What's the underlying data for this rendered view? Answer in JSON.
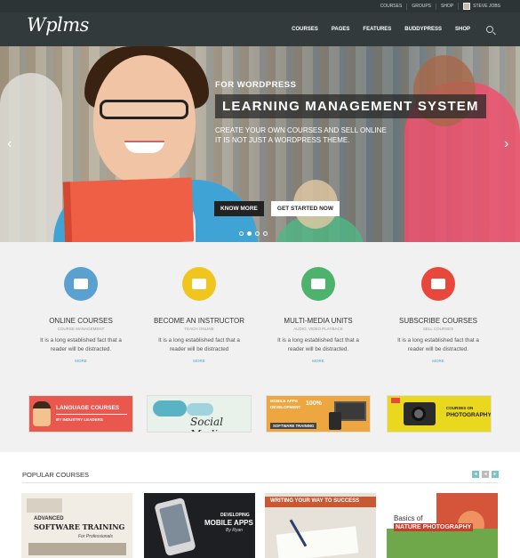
{
  "topbar": {
    "links": [
      "COURSES",
      "GROUPS",
      "SHOP"
    ],
    "user": "STEVE JOBS"
  },
  "header": {
    "logo": "Wplms",
    "nav": [
      "COURSES",
      "PAGES",
      "FEATURES",
      "BUDDYPRESS",
      "SHOP"
    ]
  },
  "hero": {
    "small": "FOR WORDPRESS",
    "title": "LEARNING MANAGEMENT SYSTEM",
    "line1": "CREATE YOUR OWN COURSES AND SELL ONLINE",
    "line2": "IT IS NOT JUST A WORDPRESS THEME.",
    "btn1": "KNOW MORE",
    "btn2": "GET STARTED NOW",
    "slide_count": 4,
    "active_slide": 1
  },
  "features": [
    {
      "title": "ONLINE COURSES",
      "sub": "COURSE MANAGEMENT",
      "desc": "It is a long established fact that a reader will be distracted.",
      "more": "MORE",
      "color": "#5aa0d1",
      "icon": "monitor-podium-icon"
    },
    {
      "title": "BECOME AN INSTRUCTOR",
      "sub": "TEACH ONLINE",
      "desc": "It is a long established fact that a reader will be distracted",
      "more": "MORE",
      "color": "#f0c51d",
      "icon": "instructor-board-icon"
    },
    {
      "title": "MULTI-MEDIA UNITS",
      "sub": "AUDIO, VIDEO PLAYBACK",
      "desc": "It is a long established fact that a reader will be distracted.",
      "more": "MORE",
      "color": "#4db26c",
      "icon": "presentation-screen-icon"
    },
    {
      "title": "SUBSCRIBE COURSES",
      "sub": "SELL COURSES",
      "desc": "It is a long established fact that a reader will be distracted.",
      "more": "MORE",
      "color": "#e8473b",
      "icon": "student-desk-icon"
    }
  ],
  "banners": {
    "b1": {
      "line1": "LANGUAGE COURSES",
      "line2": "BY INDUSTRY LEADERS"
    },
    "b2": {
      "line1": "Social Media"
    },
    "b3": {
      "line1": "MOBILE APPS",
      "line2": "DEVELOPMENT",
      "line3": "100%",
      "line4": "SOFTWARE TRAINING"
    },
    "b4": {
      "line1": "COURSES ON",
      "line2": "PHOTOGRAPHY"
    }
  },
  "popular": {
    "title": "POPULAR COURSES",
    "cards": [
      {
        "line1": "ADVANCED",
        "line2": "SOFTWARE TRAINING",
        "line3": "For Professionals"
      },
      {
        "line1": "DEVELOPING",
        "line2": "MOBILE APPS",
        "line3": "By Ryan"
      },
      {
        "line1": "WRITING YOUR WAY TO SUCCESS"
      },
      {
        "line1": "Basics of",
        "line2": "NATURE PHOTOGRAPHY"
      }
    ]
  }
}
